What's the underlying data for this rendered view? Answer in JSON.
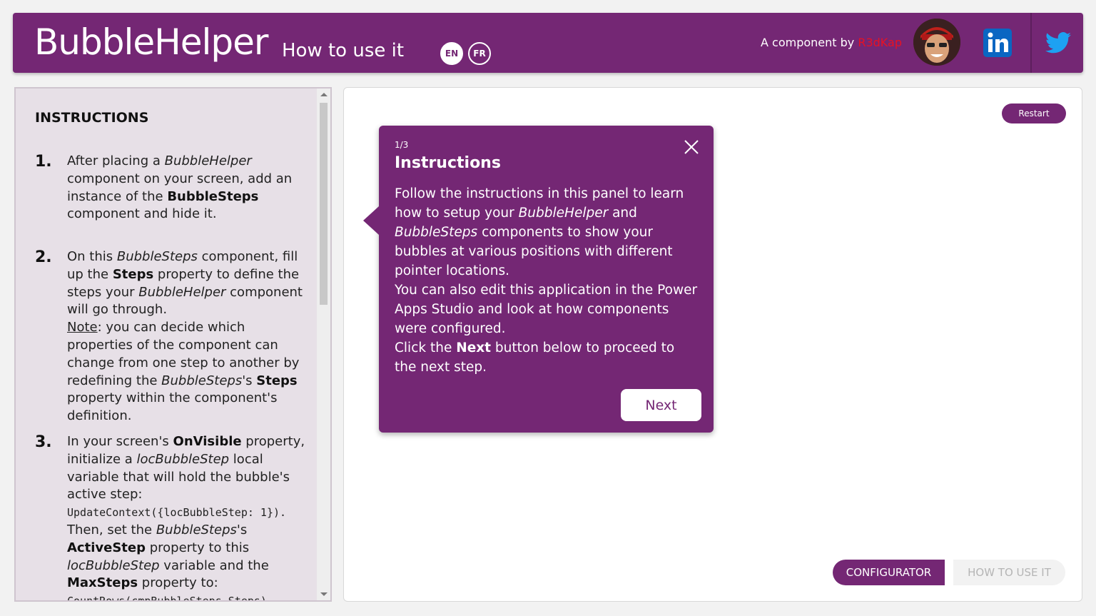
{
  "header": {
    "app_title": "BubbleHelper",
    "subtitle": "How to use it",
    "lang_en": "EN",
    "lang_fr": "FR",
    "byline_prefix": "A component by ",
    "byline_author": "R3dKap",
    "author_color": "#e81123"
  },
  "instructions": {
    "title": "INSTRUCTIONS",
    "steps": [
      {
        "number": "1.",
        "parts": [
          "After placing a ",
          "BubbleHelper",
          " component on your screen, add an instance of the ",
          "BubbleSteps",
          " component and hide it."
        ]
      },
      {
        "number": "2.",
        "parts": [
          "On this ",
          "BubbleSteps",
          " component, fill up the ",
          "Steps",
          " property to define the steps your ",
          "BubbleHelper",
          " component will go through.",
          "Note",
          ": you can decide which properties of the component can change from one step to another by redefining the ",
          "BubbleSteps",
          "'s ",
          "Steps",
          " property within the component's definition."
        ]
      },
      {
        "number": "3.",
        "parts": [
          "In your screen's ",
          "OnVisible",
          " property, initialize a ",
          "locBubbleStep",
          " local variable that will hold the bubble's active step: ",
          "UpdateContext({locBubbleStep: 1}).",
          "Then, set the ",
          "BubbleSteps",
          "'s ",
          "ActiveStep",
          " property to this ",
          "locBubbleStep",
          " variable and the ",
          "MaxSteps",
          " property to:",
          "CountRows(cmpBubbleSteps.Steps)"
        ]
      }
    ]
  },
  "main": {
    "restart_label": "Restart"
  },
  "bubble": {
    "step_indicator": "1/3",
    "title": "Instructions",
    "body": [
      "Follow the instructions in this panel to learn how to setup your ",
      "BubbleHelper",
      " and ",
      "BubbleSteps",
      " components to show your bubbles at various positions with different pointer locations.",
      "You can also edit this application in the Power Apps Studio and look at how components were configured.",
      "Click the ",
      "Next",
      " button below to proceed to the next step."
    ],
    "next_label": "Next"
  },
  "tabs": {
    "configurator": "CONFIGURATOR",
    "how_to_use": "HOW TO USE IT"
  },
  "icons": {
    "close": "close-icon",
    "linkedin": "linkedin-icon",
    "twitter": "twitter-icon",
    "avatar": "author-avatar"
  },
  "colors": {
    "brand": "#742774",
    "linkedin": "#0a66c2",
    "twitter": "#1da1f2"
  }
}
